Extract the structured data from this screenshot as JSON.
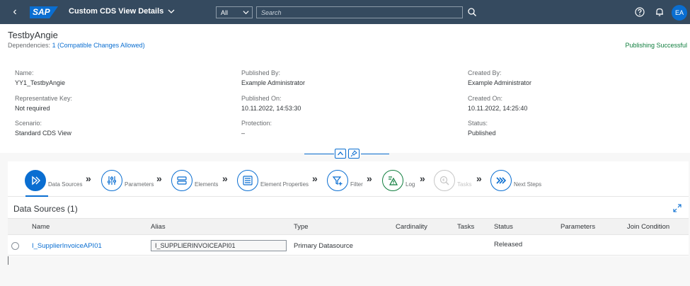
{
  "shell": {
    "logo": "SAP",
    "title": "Custom CDS View Details",
    "scope": "All",
    "search_placeholder": "Search",
    "avatar_initials": "EA"
  },
  "header": {
    "object_title": "TestbyAngie",
    "dependencies_label": "Dependencies:",
    "dependencies_link": "1 (Compatible Changes Allowed)",
    "publish_status": "Publishing Successful",
    "fields": {
      "name": {
        "label": "Name:",
        "value": "YY1_TestbyAngie"
      },
      "rep_key": {
        "label": "Representative Key:",
        "value": "Not required"
      },
      "scenario": {
        "label": "Scenario:",
        "value": "Standard CDS View"
      },
      "published_by": {
        "label": "Published By:",
        "value": "Example Administrator"
      },
      "published_on": {
        "label": "Published On:",
        "value": "10.11.2022, 14:53:30"
      },
      "protection": {
        "label": "Protection:",
        "value": "–"
      },
      "created_by": {
        "label": "Created By:",
        "value": "Example Administrator"
      },
      "created_on": {
        "label": "Created On:",
        "value": "10.11.2022, 14:25:40"
      },
      "status": {
        "label": "Status:",
        "value": "Published"
      }
    }
  },
  "steps": [
    {
      "label": "Data Sources",
      "icon": "data-sources-icon",
      "active": true
    },
    {
      "label": "Parameters",
      "icon": "parameters-icon"
    },
    {
      "label": "Elements",
      "icon": "elements-icon"
    },
    {
      "label": "Element Properties",
      "icon": "element-properties-icon"
    },
    {
      "label": "Filter",
      "icon": "filter-add-icon"
    },
    {
      "label": "Log",
      "icon": "log-warning-icon"
    },
    {
      "label": "Tasks",
      "icon": "tasks-icon",
      "disabled": true
    },
    {
      "label": "Next Steps",
      "icon": "next-steps-icon"
    }
  ],
  "section": {
    "title": "Data Sources (1)",
    "columns": [
      "Name",
      "Alias",
      "Type",
      "Cardinality",
      "Tasks",
      "Status",
      "Parameters",
      "Join Condition"
    ],
    "rows": [
      {
        "name": "I_SupplierInvoiceAPI01",
        "alias": "I_SUPPLIERINVOICEAPI01",
        "type": "Primary Datasource",
        "cardinality": "",
        "tasks": "",
        "status": "Released",
        "parameters": "",
        "join_condition": ""
      }
    ]
  },
  "colors": {
    "shell": "#354a5f",
    "accent": "#0a6ed1",
    "success": "#107e3e"
  }
}
